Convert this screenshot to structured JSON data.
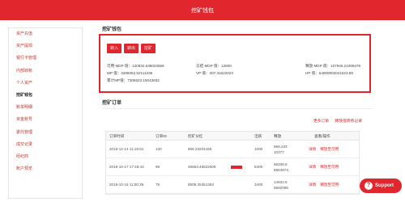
{
  "header": {
    "title": "挖矿钱包"
  },
  "sidebar": {
    "items": [
      {
        "label": "资产充值"
      },
      {
        "label": "资产提现"
      },
      {
        "label": "银行卡管理"
      },
      {
        "label": "内部转账"
      },
      {
        "label": "个人资产"
      },
      {
        "label": "挖矿钱包"
      },
      {
        "label": "账单明细"
      },
      {
        "label": "资金账号"
      },
      {
        "label": "委托管理"
      },
      {
        "label": "成交记录"
      },
      {
        "label": "经纪商"
      },
      {
        "label": "账户预览"
      }
    ]
  },
  "wallet": {
    "title": "挖矿钱包",
    "buttons": {
      "in": "转入",
      "out": "转出",
      "mine": "挖矿"
    },
    "row1": {
      "a": "可用 MDP 值：120832.638023556",
      "b": "冻结 MDP 值：12800",
      "c": "释放 MDP 值：107946.21009476"
    },
    "row2": {
      "a": "MP 值：3285052.82111336",
      "b": "VP 值：307.31622023",
      "c": "HP 值：54000002041523.89"
    },
    "row3": {
      "a": "累计MP值：7308623.15043832"
    }
  },
  "orders": {
    "title": "挖矿订单",
    "links": {
      "more": "更多订单",
      "release": "释放值转移记录"
    },
    "headers": {
      "time": "订单时间",
      "id": "订单ID",
      "mined": "挖矿分红",
      "active": "活跃",
      "power": "释放",
      "op": "查看/操作"
    },
    "rows": [
      {
        "time": "2018-12-14 11:19:51",
        "id": "130",
        "mined": "866.23204155",
        "active": "1000",
        "power1": "866.233",
        "power2": "10377",
        "detail": "详情",
        "release": "释放至可用"
      },
      {
        "time": "2018-10-17 17:48:43",
        "id": "99",
        "mined": "48653.46522509",
        "active": "8400",
        "power1": "68336.8",
        "power2": "8884873",
        "detail": "详情",
        "release": "释放至可用"
      },
      {
        "time": "2018-10-15 11:50:25",
        "id": "76",
        "mined": "8509.25351363",
        "active": "3400",
        "power1": "14932.5",
        "power2": "5582086",
        "detail": "详情",
        "release": "释放至可用"
      }
    ]
  },
  "support": {
    "label": "Support",
    "icon": "?"
  }
}
